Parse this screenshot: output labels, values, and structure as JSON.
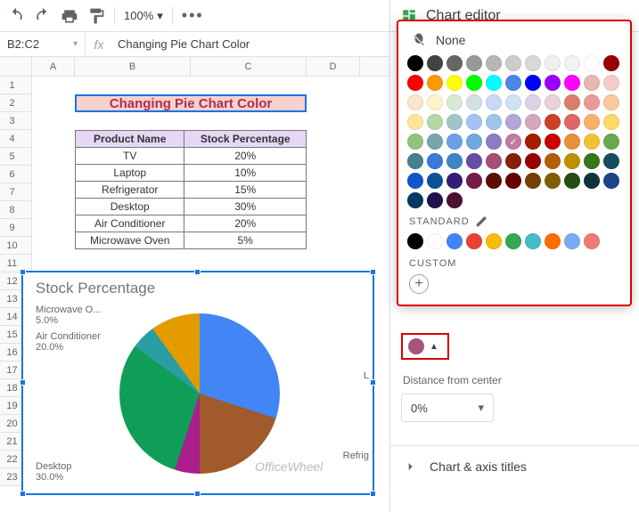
{
  "toolbar": {
    "zoom": "100%"
  },
  "fx": {
    "cellref": "B2:C2",
    "value": "Changing Pie Chart Color"
  },
  "columns": [
    "A",
    "B",
    "C",
    "D"
  ],
  "rows": [
    "1",
    "2",
    "3",
    "4",
    "5",
    "6",
    "7",
    "8",
    "9",
    "10",
    "11",
    "12",
    "13",
    "14",
    "15",
    "16",
    "17",
    "18",
    "19",
    "20",
    "21",
    "22",
    "23"
  ],
  "title": "Changing Pie Chart Color",
  "table": {
    "headers": [
      "Product Name",
      "Stock Percentage"
    ],
    "rows": [
      [
        "TV",
        "20%"
      ],
      [
        "Laptop",
        "10%"
      ],
      [
        "Refrigerator",
        "15%"
      ],
      [
        "Desktop",
        "30%"
      ],
      [
        "Air Conditioner",
        "20%"
      ],
      [
        "Microwave Oven",
        "5%"
      ]
    ]
  },
  "chart_data": {
    "type": "pie",
    "title": "Stock Percentage",
    "categories": [
      "TV",
      "Laptop",
      "Refrigerator",
      "Desktop",
      "Air Conditioner",
      "Microwave Oven"
    ],
    "values": [
      20,
      10,
      15,
      30,
      20,
      5
    ],
    "labels": {
      "microwave": "Microwave O...",
      "microwave_pct": "5.0%",
      "aircon": "Air Conditioner",
      "aircon_pct": "20.0%",
      "desktop": "Desktop",
      "desktop_pct": "30.0%",
      "refrig": "Refrig",
      "laptop_short": "L"
    }
  },
  "watermark": "OfficeWheel",
  "sidepanel": {
    "title": "Chart editor",
    "popup_none": "None",
    "standard_label": "STANDARD",
    "custom_label": "CUSTOM",
    "distance_label": "Distance from center",
    "distance_value": "0%",
    "section_title": "Chart & axis titles",
    "selected_color": "#a7537e",
    "palette_main": [
      "#000000",
      "#434343",
      "#666666",
      "#999999",
      "#b7b7b7",
      "#cccccc",
      "#d9d9d9",
      "#efefef",
      "#f3f3f3",
      "#ffffff",
      "#980000",
      "#ff0000",
      "#ff9900",
      "#ffff00",
      "#00ff00",
      "#00ffff",
      "#4a86e8",
      "#0000ff",
      "#9900ff",
      "#ff00ff",
      "#e6b8af",
      "#f4cccc",
      "#fce5cd",
      "#fff2cc",
      "#d9ead3",
      "#d0e0e3",
      "#c9daf8",
      "#cfe2f3",
      "#d9d2e9",
      "#ead1dc",
      "#dd7e6b",
      "#ea9999",
      "#f9cb9c",
      "#ffe599",
      "#b6d7a8",
      "#a2c4c9",
      "#a4c2f4",
      "#9fc5e8",
      "#b4a7d6",
      "#d5a6bd",
      "#cc4125",
      "#e06666",
      "#f6b26b",
      "#ffd966",
      "#93c47d",
      "#76a5af",
      "#6d9eeb",
      "#6fa8dc",
      "#8e7cc3",
      "#c27ba0",
      "#a61c00",
      "#cc0000",
      "#e69138",
      "#f1c232",
      "#6aa84f",
      "#45818e",
      "#3c78d8",
      "#3d85c6",
      "#674ea7",
      "#a64d79",
      "#85200c",
      "#990000",
      "#b45f06",
      "#bf9000",
      "#38761d",
      "#134f5c",
      "#1155cc",
      "#0b5394",
      "#351c75",
      "#741b47",
      "#5b0f00",
      "#660000",
      "#783f04",
      "#7f6000",
      "#274e13",
      "#0c343d",
      "#1c4587",
      "#073763",
      "#20124d",
      "#4c1130"
    ],
    "palette_standard": [
      "#000000",
      "#ffffff",
      "#4285f4",
      "#ea4335",
      "#fbbc04",
      "#34a853",
      "#46bdc6",
      "#ff6d01",
      "#7baaf7",
      "#f07b72"
    ],
    "checked_index": 49
  }
}
